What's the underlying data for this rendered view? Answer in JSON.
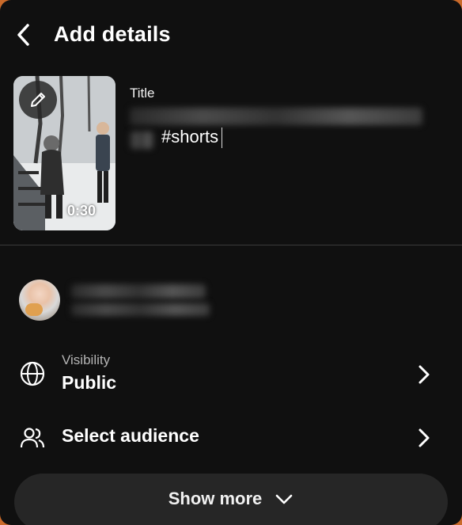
{
  "header": {
    "title": "Add details"
  },
  "video": {
    "duration": "0:30",
    "title_label": "Title",
    "title_visible_text": "#shorts"
  },
  "settings": {
    "visibility_label": "Visibility",
    "visibility_value": "Public",
    "audience_label": "Select audience"
  },
  "footer": {
    "show_more_label": "Show more"
  },
  "icons": {
    "back": "back-arrow-icon",
    "edit": "pencil-icon",
    "visibility": "globe-icon",
    "audience": "people-icon",
    "chevron": "chevron-right-icon",
    "expand": "chevron-down-icon"
  },
  "colors": {
    "background": "#101010",
    "frame_accent": "#c96a2a",
    "button_bg": "#262626"
  }
}
